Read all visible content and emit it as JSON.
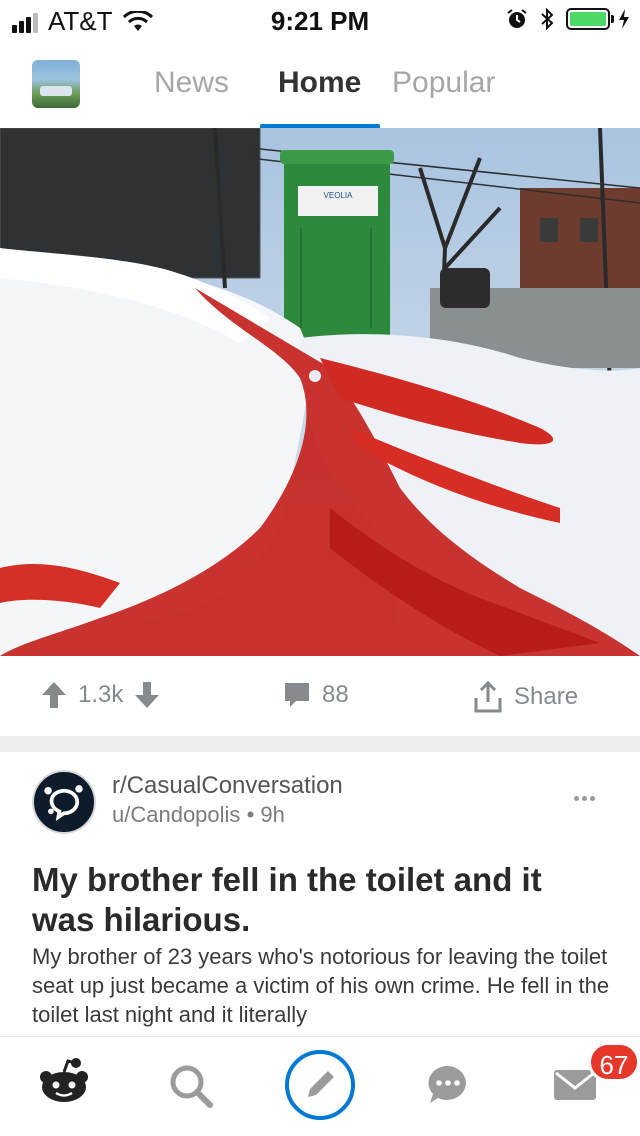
{
  "status_bar": {
    "carrier": "AT&T",
    "time": "9:21 PM",
    "battery_level": 1.0,
    "colors": {
      "battery": "#4cd964"
    }
  },
  "header": {
    "tabs": [
      {
        "label": "News",
        "active": false
      },
      {
        "label": "Home",
        "active": true
      },
      {
        "label": "Popular",
        "active": false
      }
    ],
    "accent_color": "#0079d3"
  },
  "post_image": {
    "portable_toilet_sign": "VEOLIA"
  },
  "actions": {
    "score": "1.3k",
    "comments": "88",
    "share_label": "Share"
  },
  "post": {
    "subreddit": "r/CasualConversation",
    "author": "u/Candopolis",
    "separator": "•",
    "age": "9h",
    "title": "My brother fell in the toilet and it was hilarious.",
    "body": "My brother of 23 years who's notorious for leaving the toilet seat up just became a victim of his own crime. He fell in the toilet last night and it literally"
  },
  "tab_bar": {
    "icons": [
      "reddit-home-icon",
      "search-icon",
      "create-post-icon",
      "chat-icon",
      "inbox-icon"
    ],
    "inbox_badge": "67",
    "colors": {
      "badge": "#e7372a",
      "post_button": "#0079d3"
    }
  }
}
